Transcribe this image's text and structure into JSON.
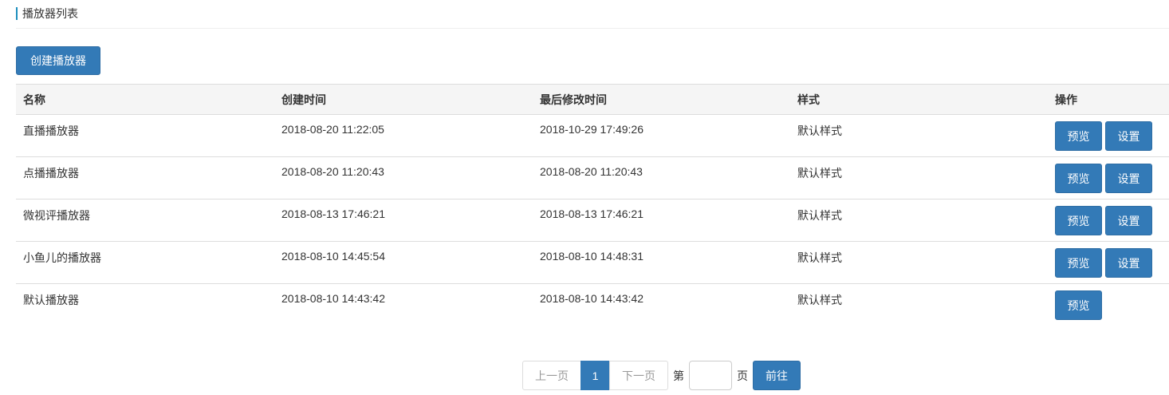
{
  "header": {
    "title": "播放器列表"
  },
  "toolbar": {
    "create_label": "创建播放器"
  },
  "table": {
    "columns": [
      "名称",
      "创建时间",
      "最后修改时间",
      "样式",
      "操作"
    ],
    "rows": [
      {
        "name": "直播播放器",
        "created": "2018-08-20 11:22:05",
        "modified": "2018-10-29 17:49:26",
        "style": "默认样式",
        "actions": [
          "预览",
          "设置"
        ]
      },
      {
        "name": "点播播放器",
        "created": "2018-08-20 11:20:43",
        "modified": "2018-08-20 11:20:43",
        "style": "默认样式",
        "actions": [
          "预览",
          "设置"
        ]
      },
      {
        "name": "微视评播放器",
        "created": "2018-08-13 17:46:21",
        "modified": "2018-08-13 17:46:21",
        "style": "默认样式",
        "actions": [
          "预览",
          "设置"
        ]
      },
      {
        "name": "小鱼儿的播放器",
        "created": "2018-08-10 14:45:54",
        "modified": "2018-08-10 14:48:31",
        "style": "默认样式",
        "actions": [
          "预览",
          "设置"
        ]
      },
      {
        "name": "默认播放器",
        "created": "2018-08-10 14:43:42",
        "modified": "2018-08-10 14:43:42",
        "style": "默认样式",
        "actions": [
          "预览"
        ]
      }
    ]
  },
  "pagination": {
    "prev_label": "上一页",
    "current_page": "1",
    "next_label": "下一页",
    "page_prefix": "第",
    "page_input_value": "",
    "page_suffix": "页",
    "go_label": "前往"
  },
  "colors": {
    "primary": "#337ab7",
    "header_accent": "#1d8fbd",
    "table_header_bg": "#f5f5f5"
  }
}
